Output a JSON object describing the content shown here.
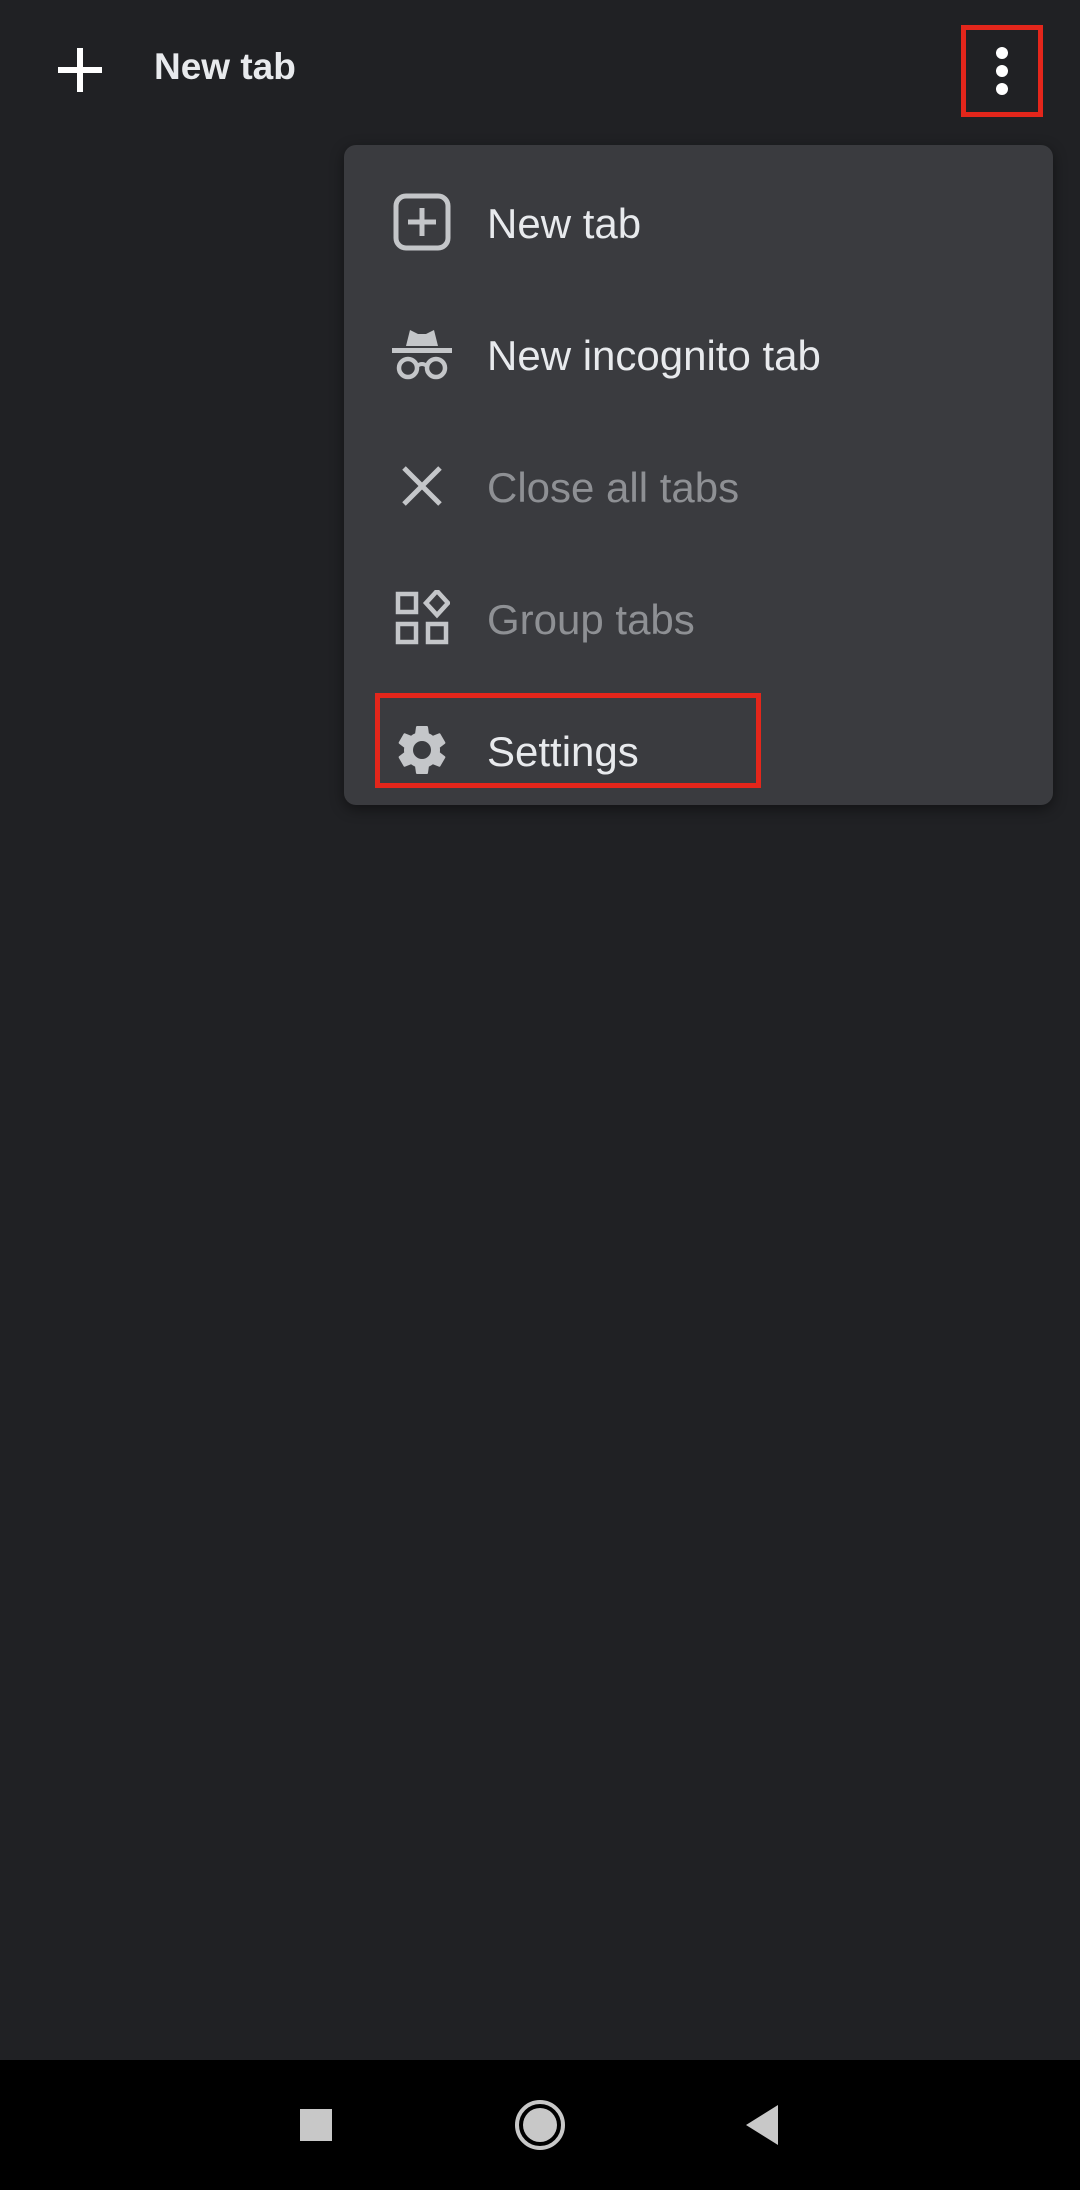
{
  "toolbar": {
    "title": "New tab",
    "add_icon": "plus-icon",
    "more_icon": "more-vert-icon"
  },
  "menu": {
    "items": [
      {
        "label": "New tab",
        "icon": "add-box-icon",
        "enabled": true
      },
      {
        "label": "New incognito tab",
        "icon": "incognito-icon",
        "enabled": true
      },
      {
        "label": "Close all tabs",
        "icon": "close-icon",
        "enabled": false
      },
      {
        "label": "Group tabs",
        "icon": "group-tabs-icon",
        "enabled": false
      },
      {
        "label": "Settings",
        "icon": "gear-icon",
        "enabled": true
      }
    ]
  },
  "navbar": {
    "recents_icon": "recents-square-icon",
    "home_icon": "home-circle-icon",
    "back_icon": "back-triangle-icon"
  },
  "colors": {
    "background": "#202124",
    "menu_background": "#3a3b3f",
    "text": "#e8eaed",
    "text_disabled": "#8e9094",
    "highlight": "#e3261b",
    "navbar": "#000000"
  }
}
